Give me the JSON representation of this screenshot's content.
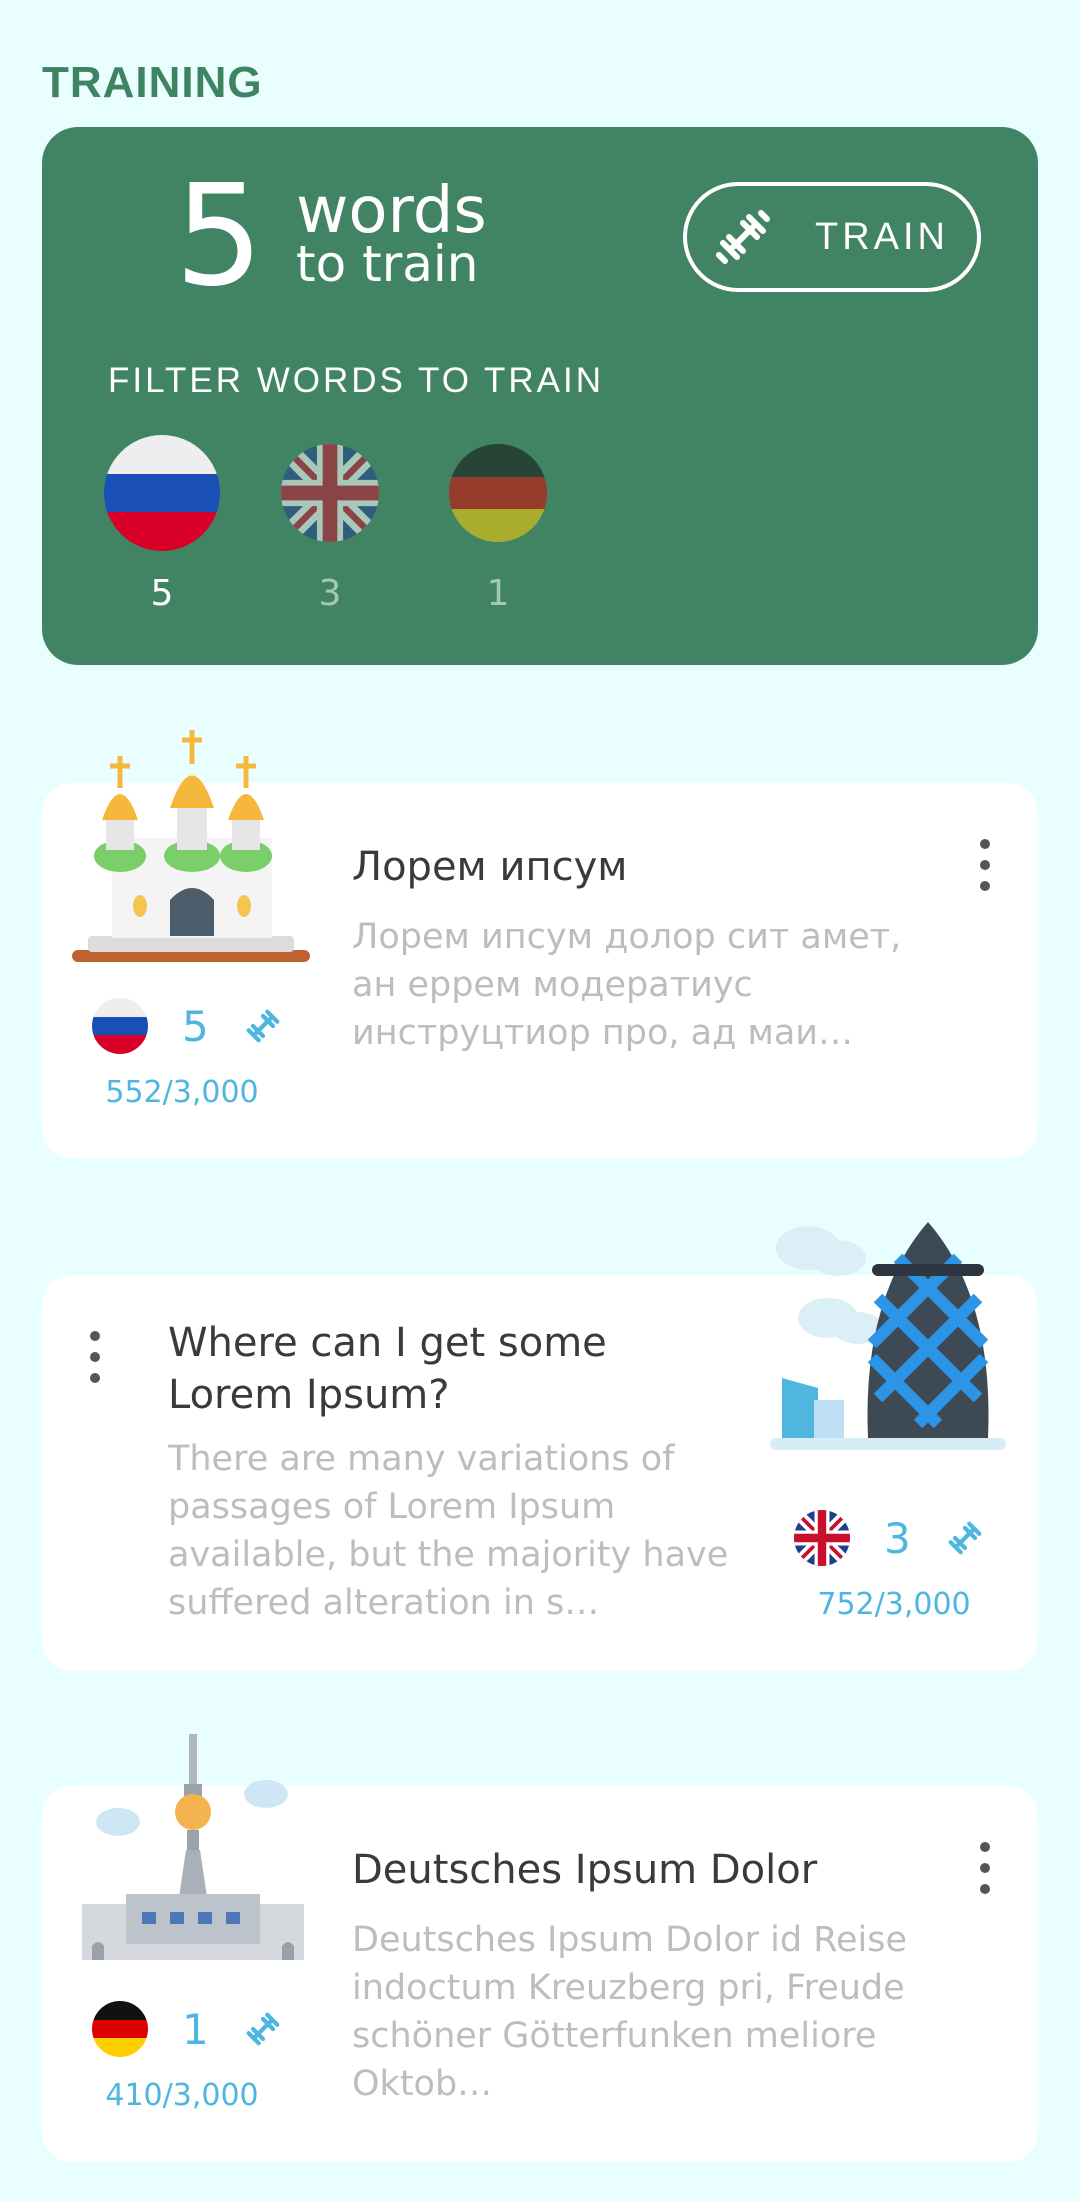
{
  "section_title": "TRAINING",
  "training": {
    "count": "5",
    "words_label": "words",
    "sub_label": "to train",
    "train_button": "TRAIN",
    "filter_title": "FILTER WORDS TO TRAIN",
    "filters": [
      {
        "lang": "Russian",
        "count": "5"
      },
      {
        "lang": "English",
        "count": "3"
      },
      {
        "lang": "German",
        "count": "1"
      }
    ]
  },
  "lessons": [
    {
      "title": "Лорем ипсум",
      "description": "Лорем ипсум долор сит амет, ан еррем модератиус инструцтиор про, ад маи…",
      "count": "5",
      "progress": "552/3,000",
      "language": "Russian"
    },
    {
      "title": "Where can I get some Lorem Ipsum?",
      "description": "There are many variations of passages of Lorem Ipsum available, but the majority have suffered alteration in s…",
      "count": "3",
      "progress": "752/3,000",
      "language": "English"
    },
    {
      "title": "Deutsches Ipsum Dolor",
      "description": "Deutsches Ipsum Dolor id Reise indoctum Kreuzberg pri, Freude schöner Götterfunken meliore Oktob…",
      "count": "1",
      "progress": "410/3,000",
      "language": "German"
    }
  ],
  "colors": {
    "background": "#e9fefe",
    "training_card": "#418463",
    "accent": "#4fb6e0",
    "title_green": "#3f8462"
  },
  "icons": [
    "dumbbell-icon",
    "kebab-menu-icon",
    "russia-flag-icon",
    "uk-flag-icon",
    "germany-flag-icon"
  ]
}
